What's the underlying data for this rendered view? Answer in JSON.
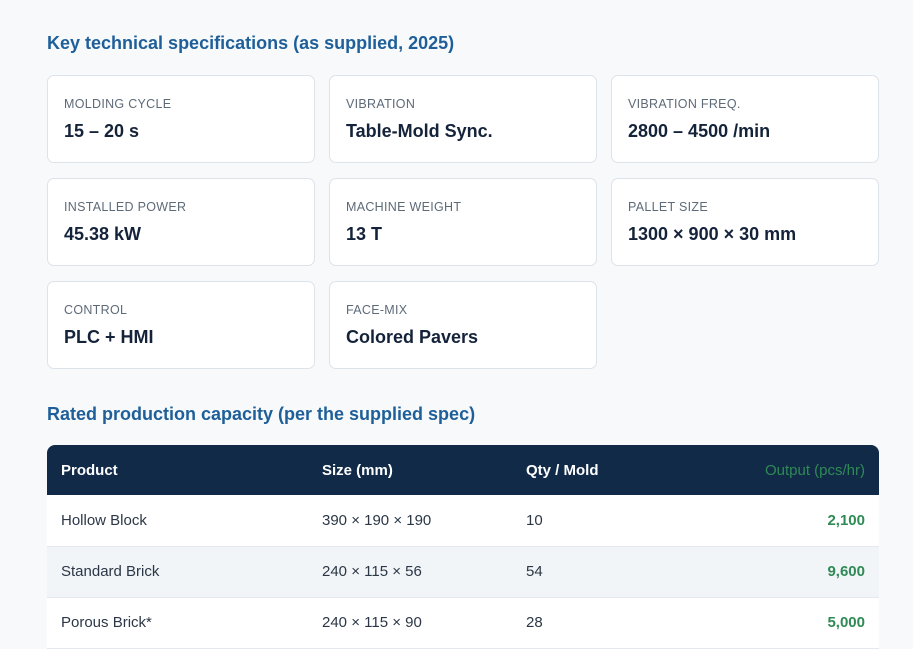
{
  "specs": {
    "title": "Key technical specifications (as supplied, 2025)",
    "items": [
      {
        "label": "Molding cycle",
        "value": "15 – 20 s"
      },
      {
        "label": "Vibration",
        "value": "Table-Mold Sync."
      },
      {
        "label": "Vibration freq.",
        "value": "2800 – 4500 /min"
      },
      {
        "label": "Installed power",
        "value": "45.38 kW"
      },
      {
        "label": "Machine weight",
        "value": "13 T"
      },
      {
        "label": "Pallet size",
        "value": "1300 × 900 × 30 mm"
      },
      {
        "label": "Control",
        "value": "PLC + HMI"
      },
      {
        "label": "Face-mix",
        "value": "Colored Pavers"
      }
    ]
  },
  "capacity": {
    "title": "Rated production capacity (per the supplied spec)",
    "headers": [
      "Product",
      "Size (mm)",
      "Qty / Mold",
      "Output (pcs/hr)"
    ],
    "rows": [
      [
        "Hollow Block",
        "390 × 190 × 190",
        "10",
        "2,100"
      ],
      [
        "Standard Brick",
        "240 × 115 × 56",
        "54",
        "9,600"
      ],
      [
        "Porous Brick*",
        "240 × 115 × 90",
        "28",
        "5,000"
      ]
    ]
  },
  "colors": {
    "heading": "#1f5f99",
    "table_header_bg": "#102a48",
    "output_green": "#2f8a55"
  }
}
